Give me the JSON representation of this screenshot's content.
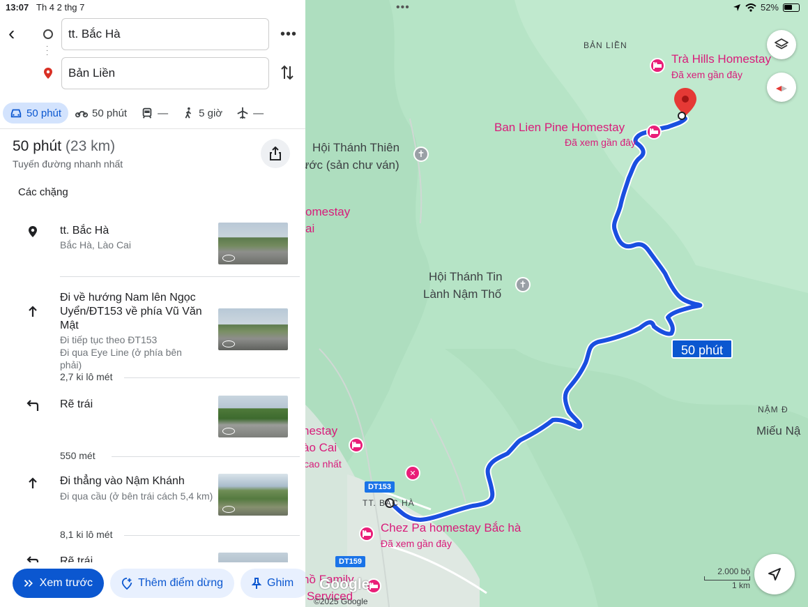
{
  "status": {
    "time": "13:07",
    "date": "Th 4 2 thg 7",
    "battery": "52%"
  },
  "search": {
    "origin": "tt. Bắc Hà",
    "destination": "Bản Liền"
  },
  "modes": [
    {
      "icon": "car-icon",
      "label": "50 phút",
      "active": true
    },
    {
      "icon": "motorbike-icon",
      "label": "50 phút"
    },
    {
      "icon": "transit-icon",
      "label": "—"
    },
    {
      "icon": "walk-icon",
      "label": "5 giờ"
    },
    {
      "icon": "flight-icon",
      "label": "—"
    }
  ],
  "summary": {
    "time": "50 phút",
    "distance": "(23 km)",
    "subtitle": "Tuyến đường nhanh nhất"
  },
  "legs_title": "Các chặng",
  "steps": [
    {
      "icon": "location-pin-icon",
      "title": "tt. Bắc Hà",
      "sub": [
        "Bắc Hà, Lào Cai"
      ]
    },
    {
      "icon": "arrow-up-icon",
      "title": "Đi về hướng Nam lên Ngọc Uyển/ĐT153 về phía Vũ Văn Mật",
      "sub": [
        "Đi tiếp tục theo ĐT153",
        "Đi qua Eye Line (ở phía bên phải)"
      ],
      "distance": "2,7 ki lô mét"
    },
    {
      "icon": "turn-left-icon",
      "title": "Rẽ trái",
      "sub": [],
      "distance": "550 mét"
    },
    {
      "icon": "arrow-up-icon",
      "title": "Đi thẳng vào Nậm Khánh",
      "sub": [
        "Đi qua cầu (ở bên trái cách 5,4 km)"
      ],
      "distance": "8,1 ki lô mét"
    },
    {
      "icon": "turn-left-icon",
      "title": "Rẽ trái"
    }
  ],
  "actions": {
    "preview": "Xem trước",
    "add_stop": "Thêm điểm dừng",
    "pin": "Ghim"
  },
  "map": {
    "labels": {
      "ban_lien_area": "BẢN LIỀN",
      "tra_hills": "Trà Hills Homestay",
      "tra_hills_sub": "Đã xem gần đây",
      "ban_lien_pine": "Ban Lien Pine Homestay",
      "ban_lien_pine_sub": "Đã xem gần đây",
      "hoi_thanh_thien": "Hội Thánh Thiên",
      "hoi_thanh_thien_2": "ước (sản chư ván)",
      "homestay_left": "omestay",
      "homestay_left_2": "ai",
      "hoi_thanh_tin": "Hội Thánh Tin",
      "hoi_thanh_tin_2": "Lành Nậm Thố",
      "homestay_left_b": "nestay",
      "homestay_left_b2": "ào Cai",
      "homestay_left_b3": "cao nhất",
      "bac_ha_town": "TT. BẮC HÀ",
      "chez_pa": "Chez Pa homestay Bắc hà",
      "chez_pa_sub": "Đã xem gần đây",
      "family": "hồ Family",
      "serviced": "Serviced",
      "nam_e": "NẬM Đ",
      "mieu_nam": "Miếu Nậ",
      "road_dt153": "DT153",
      "road_dt159": "DT159",
      "duration": "50 phút",
      "scale_top": "2.000 bộ",
      "scale_bottom": "1 km",
      "google": "Google",
      "copyright": "©2025 Google"
    }
  }
}
